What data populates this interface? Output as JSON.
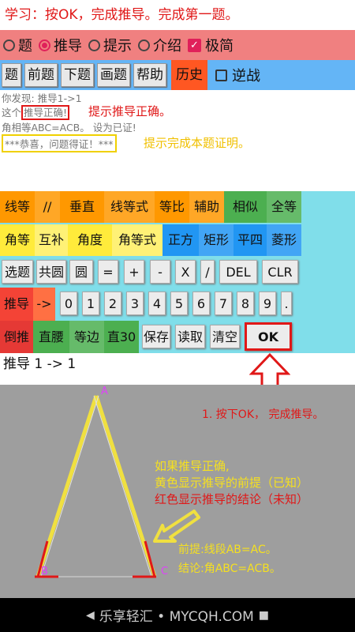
{
  "instruction": "学习：按OK，完成推导。完成第一题。",
  "modes": [
    {
      "label": "题",
      "type": "radio",
      "checked": false
    },
    {
      "label": "推导",
      "type": "radio",
      "checked": true
    },
    {
      "label": "提示",
      "type": "radio",
      "checked": false
    },
    {
      "label": "介绍",
      "type": "radio",
      "checked": false
    },
    {
      "label": "极简",
      "type": "checkbox",
      "checked": true
    }
  ],
  "toolbar": {
    "buttons": [
      "题",
      "前题",
      "下题",
      "画题",
      "帮助"
    ],
    "history": "历史",
    "reverse": "逆战"
  },
  "output": {
    "found": "你发现:  推导1->1",
    "line2_prefix": "这个",
    "line2_box": "推导正确!",
    "hint_correct": "提示推导正确。",
    "line3": "角相等ABC=ACB。 设为已证!",
    "congrats": "***恭喜，问题得证！***",
    "hint_complete": "提示完成本题证明。"
  },
  "keypad": {
    "row1": [
      "线等",
      "//",
      "垂直",
      "线等式",
      "等比",
      "辅助",
      "相似",
      "全等"
    ],
    "row2": [
      "角等",
      "互补",
      "角度",
      "角等式",
      "正方",
      "矩形",
      "平四",
      "菱形"
    ],
    "row3": [
      "选题",
      "共圆",
      "圆",
      "=",
      "+",
      "-",
      "X",
      "/",
      "DEL",
      "CLR"
    ],
    "row4": [
      "推导",
      "->",
      "0",
      "1",
      "2",
      "3",
      "4",
      "5",
      "6",
      "7",
      "8",
      "9",
      "."
    ],
    "row5": [
      "倒推",
      "直腰",
      "等边",
      "直30",
      "保存",
      "读取",
      "清空",
      "OK"
    ]
  },
  "expression": "推导 1 -> 1",
  "annotations": {
    "press_ok": "1. 按下OK，  完成推导。",
    "if_correct": "如果推导正确,",
    "yellow_desc": "黄色显示推导的前提（已知）",
    "red_desc": "红色显示推导的结论（未知）",
    "premise": "前提:线段AB=AC。",
    "conclusion": "结论:角ABC=ACB。"
  },
  "figure": {
    "labels": {
      "A": "A",
      "B": "B",
      "C": "C"
    }
  },
  "navbar": {
    "watermark": "乐享轻汇 • MYCQH.COM"
  }
}
